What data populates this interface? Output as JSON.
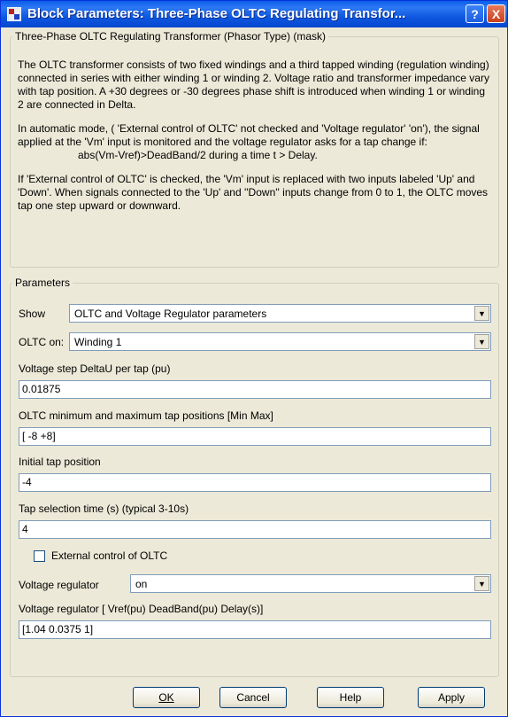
{
  "window": {
    "title": "Block Parameters: Three-Phase OLTC Regulating Transfor...",
    "help_button": "?",
    "close_button": "X"
  },
  "description": {
    "legend": "Three-Phase OLTC Regulating Transformer (Phasor Type) (mask)",
    "p1": "The OLTC transformer consists of two fixed windings and a third tapped winding (regulation winding) connected in series with either winding 1 or winding 2. Voltage ratio and  transformer impedance vary with  tap position. A +30  degrees or -30 degrees phase shift  is introduced when winding 1 or winding 2 are connected in Delta.",
    "p2": "In automatic mode, ( 'External control of OLTC' not checked and 'Voltage regulator' 'on'), the signal applied at the 'Vm' input is monitored and the voltage regulator asks for a tap change if:",
    "p2_formula": "abs(Vm-Vref)>DeadBand/2  during a time  t > Delay.",
    "p3": "If 'External control of OLTC' is checked, the 'Vm' input is replaced with two inputs labeled 'Up' and 'Down'. When signals connected to the 'Up' and ''Down'' inputs change from 0 to 1, the OLTC moves tap one step upward or downward."
  },
  "parameters": {
    "legend": "Parameters",
    "show_label": "Show",
    "show_value": "OLTC and Voltage Regulator parameters",
    "oltc_on_label": "OLTC on:",
    "oltc_on_value": "Winding 1",
    "voltage_step_label": "Voltage step DeltaU per tap (pu)",
    "voltage_step_value": "0.01875",
    "tap_positions_label": "OLTC minimum and maximum tap positions [Min Max]",
    "tap_positions_value": "[ -8  +8]",
    "initial_tap_label": "Initial tap position",
    "initial_tap_value": "-4",
    "tap_time_label": "Tap selection time (s) (typical 3-10s)",
    "tap_time_value": "4",
    "external_control_label": "External control of OLTC",
    "external_control_checked": false,
    "voltage_regulator_label": "Voltage regulator",
    "voltage_regulator_value": "on",
    "regulator_params_label": "Voltage regulator [ Vref(pu) DeadBand(pu)  Delay(s)]",
    "regulator_params_value": "[1.04   0.0375 1]"
  },
  "buttons": {
    "ok": "OK",
    "cancel": "Cancel",
    "help": "Help",
    "apply": "Apply"
  },
  "colors": {
    "titlebar": "#0a5ee8",
    "dialog_bg": "#ece9d8",
    "input_border": "#7f9db9"
  }
}
